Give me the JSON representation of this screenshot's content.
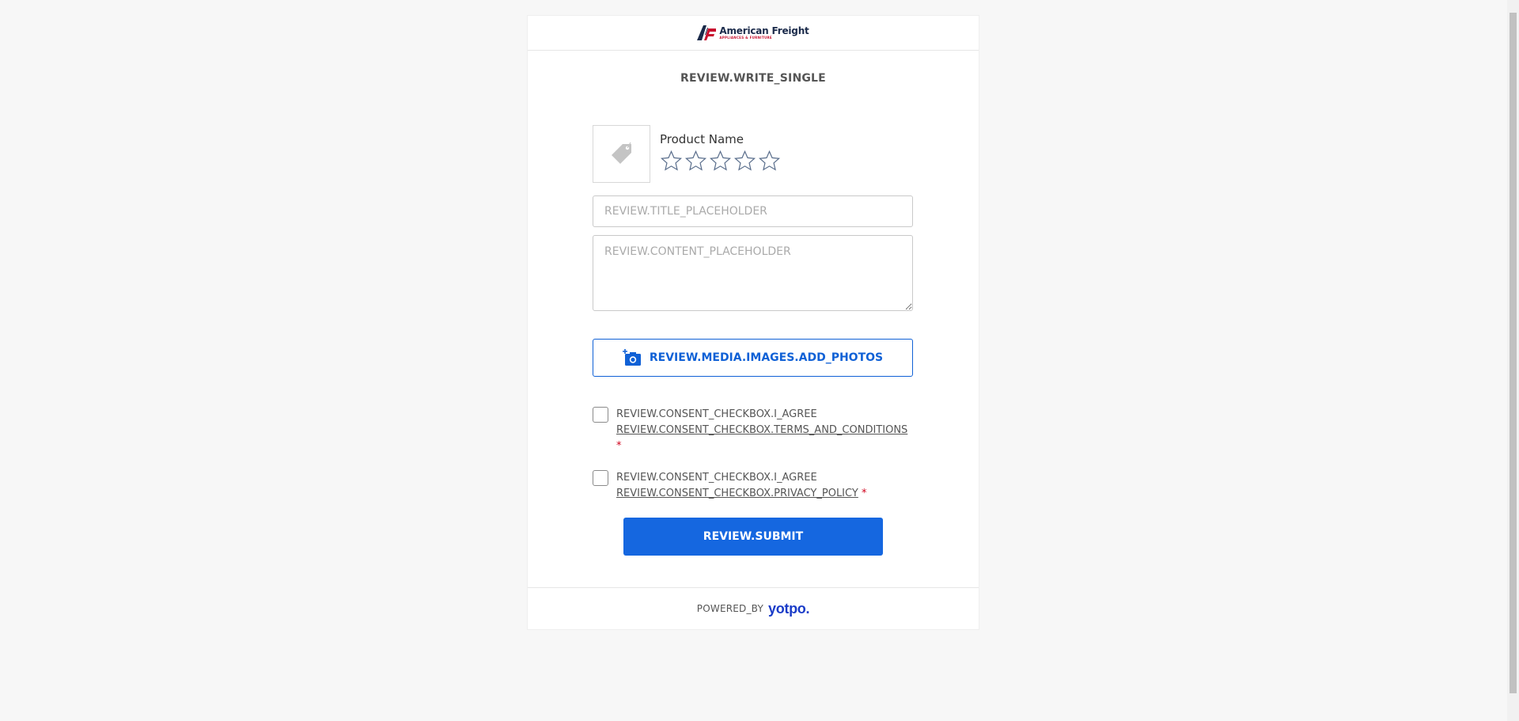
{
  "brand": {
    "name": "American Freight",
    "tagline": "APPLIANCES & FURNITURE"
  },
  "form": {
    "title": "REVIEW.WRITE_SINGLE",
    "product_name": "Product Name",
    "rating": {
      "max": 5,
      "selected": 0
    },
    "title_placeholder": "REVIEW.TITLE_PLACEHOLDER",
    "content_placeholder": "REVIEW.CONTENT_PLACEHOLDER",
    "add_photos_label": "REVIEW.MEDIA.IMAGES.ADD_PHOTOS",
    "consent_terms": {
      "prefix": "REVIEW.CONSENT_CHECKBOX.I_AGREE",
      "link": "REVIEW.CONSENT_CHECKBOX.TERMS_AND_CONDITIONS",
      "required_mark": "*",
      "checked": false
    },
    "consent_privacy": {
      "prefix": "REVIEW.CONSENT_CHECKBOX.I_AGREE",
      "link": "REVIEW.CONSENT_CHECKBOX.PRIVACY_POLICY",
      "required_mark": "*",
      "checked": false
    },
    "submit_label": "REVIEW.SUBMIT"
  },
  "footer": {
    "powered_by": "POWERED_BY",
    "provider": "yotpo."
  },
  "icons": {
    "product_placeholder": "price-tag-icon",
    "add_photos": "add-camera-icon",
    "star": "star-outline-icon"
  },
  "colors": {
    "accent": "#1567e0",
    "required": "#d0021b",
    "yotpo": "#1a3cc8",
    "brand_red": "#c8102e",
    "brand_navy": "#1a2a4a"
  }
}
